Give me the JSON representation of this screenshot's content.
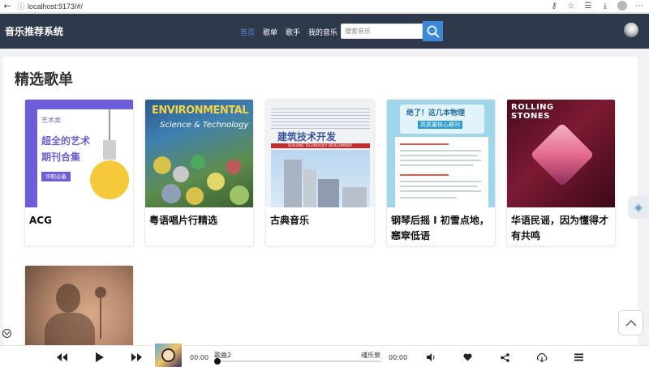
{
  "browser": {
    "url": "localhost:9173/#/",
    "icons": [
      "back-icon",
      "info-icon",
      "key-icon",
      "star-icon",
      "collections-icon",
      "download-icon",
      "profile-icon",
      "more-icon"
    ]
  },
  "header": {
    "title": "音乐推荐系统",
    "nav": [
      {
        "label": "首页",
        "active": true
      },
      {
        "label": "歌单",
        "active": false
      },
      {
        "label": "歌手",
        "active": false
      },
      {
        "label": "我的音乐",
        "active": false
      }
    ],
    "search": {
      "placeholder": "搜索音乐",
      "value": ""
    }
  },
  "main": {
    "section_title": "精选歌单",
    "playlists": [
      {
        "title": "ACG",
        "cover": {
          "badge": "艺术类",
          "line1": "超全的艺术",
          "line2": "期刊合集",
          "tag": "评职必备"
        }
      },
      {
        "title": "粤语唱片行精选",
        "cover": {
          "title": "ENVIRONMENTAL",
          "subtitle": "Science & Technology"
        }
      },
      {
        "title": "古典音乐",
        "cover": {
          "title": "建筑技术开发",
          "bar": "BUILDING TECHNOLOGY DEVELOPMENT"
        }
      },
      {
        "title": "钢琴后摇 I 初雪点地，窸窣低语",
        "cover": {
          "line1": "绝了！这几本物理",
          "line2": "高质量核心期刊"
        }
      },
      {
        "title": "华语民谣，因为懂得才有共鸣",
        "cover": {
          "line1": "ROLLING",
          "line2": "STONES"
        }
      },
      {
        "title": "",
        "cover": {}
      }
    ]
  },
  "player": {
    "current_time": "00:00",
    "total_time": "00:00",
    "song": "歌曲2",
    "artist": "魂乐泉",
    "progress": 0
  },
  "colors": {
    "header_bg": "#2e3a4b",
    "nav_active": "#4f8ad8",
    "search_button": "#3a88d6",
    "page_bg": "#f0f2f5"
  }
}
